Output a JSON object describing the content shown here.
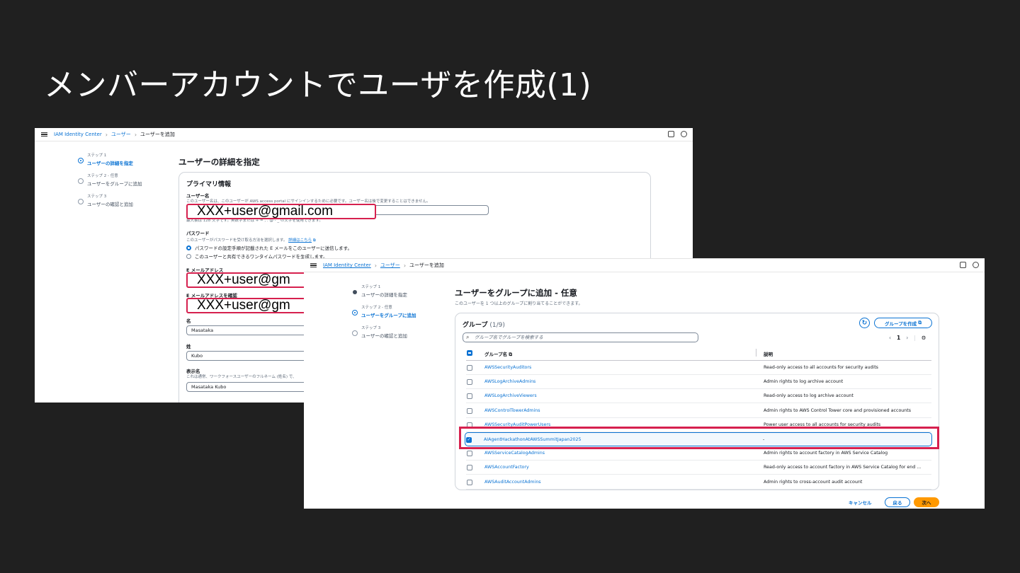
{
  "slide": {
    "title": "メンバーアカウントでユーザを作成(1)"
  },
  "shot1": {
    "breadcrumb": [
      "IAM Identity Center",
      "ユーザー",
      "ユーザーを追加"
    ],
    "steps": [
      {
        "num": "ステップ 1",
        "label": "ユーザーの詳細を指定"
      },
      {
        "num": "ステップ 2 - 任意",
        "label": "ユーザーをグループに追加"
      },
      {
        "num": "ステップ 3",
        "label": "ユーザーの確認と追加"
      }
    ],
    "heading": "ユーザーの詳細を指定",
    "panel_title": "プライマリ情報",
    "username_label": "ユーザー名",
    "username_desc": "このユーザー名は、このユーザーが AWS access portal にサインインするために必要です。ユーザー名は後で変更することはできません。",
    "username_value": "XXX+user@gmail.com",
    "username_hint": "最大長は 128 文字です。英数字または + = , . @ - _ の文字を使用できます。",
    "password_label": "パスワード",
    "password_desc": "このユーザーがパスワードを受け取る方法を選択します。",
    "password_link": "詳細はこちら",
    "radio1": "パスワードの設定手順が記載された E メールをこのユーザーに送信します。",
    "radio2": "このユーザーと共有できるワンタイムパスワードを生成します。",
    "email_label": "E メールアドレス",
    "email_value": "XXX+user@gm",
    "email_confirm_label": "E メールアドレスを確認",
    "email_confirm_value": "XXX+user@gm",
    "first_name_label": "名",
    "first_name_value": "Masataka",
    "last_name_label": "姓",
    "last_name_value": "Kubo",
    "display_name_label": "表示名",
    "display_name_desc": "これは通常、ワークフォースユーザーのフルネーム (姓名) で、",
    "display_name_value": "Masataka Kubo"
  },
  "shot2": {
    "breadcrumb": [
      "IAM Identity Center",
      "ユーザー",
      "ユーザーを追加"
    ],
    "steps": [
      {
        "num": "ステップ 1",
        "label": "ユーザーの詳細を指定"
      },
      {
        "num": "ステップ 2 - 任意",
        "label": "ユーザーをグループに追加"
      },
      {
        "num": "ステップ 3",
        "label": "ユーザーの確認と追加"
      }
    ],
    "heading": "ユーザーをグループに追加 - 任意",
    "subheading": "このユーザーを 1 つ以上のグループに割り当てることができます。",
    "groups_title": "グループ",
    "groups_count": "(1/9)",
    "create_group_button": "グループを作成",
    "search_placeholder": "グループ名でグループを検索する",
    "page_number": "1",
    "col_name": "グループ名",
    "col_desc": "説明",
    "rows": [
      {
        "name": "AWSSecurityAuditors",
        "desc": "Read-only access to all accounts for security audits",
        "checked": false
      },
      {
        "name": "AWSLogArchiveAdmins",
        "desc": "Admin rights to log archive account",
        "checked": false
      },
      {
        "name": "AWSLogArchiveViewers",
        "desc": "Read-only access to log archive account",
        "checked": false
      },
      {
        "name": "AWSControlTowerAdmins",
        "desc": "Admin rights to AWS Control Tower core and provisioned accounts",
        "checked": false
      },
      {
        "name": "AWSSecurityAuditPowerUsers",
        "desc": "Power user access to all accounts for security audits",
        "checked": false
      },
      {
        "name": "AIAgentHackathonAtAWSSummitJapan2025",
        "desc": "-",
        "checked": true
      },
      {
        "name": "AWSServiceCatalogAdmins",
        "desc": "Admin rights to account factory in AWS Service Catalog",
        "checked": false
      },
      {
        "name": "AWSAccountFactory",
        "desc": "Read-only access to account factory in AWS Service Catalog for end ...",
        "checked": false
      },
      {
        "name": "AWSAuditAccountAdmins",
        "desc": "Admin rights to cross-account audit account",
        "checked": false
      }
    ],
    "cancel_button": "キャンセル",
    "back_button": "戻る",
    "next_button": "次へ"
  },
  "colors": {
    "aws_blue": "#0972d3",
    "highlight_red": "#d6204e",
    "next_orange": "#ff9900"
  }
}
